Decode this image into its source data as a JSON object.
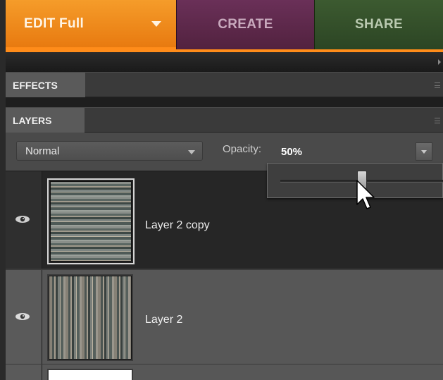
{
  "workspace_tabs": [
    {
      "label": "EDIT Full",
      "active": true,
      "color": "#e8821a"
    },
    {
      "label": "CREATE",
      "active": false,
      "color": "#5c2849"
    },
    {
      "label": "SHARE",
      "active": false,
      "color": "#34502a"
    }
  ],
  "panels": {
    "effects": {
      "title": "EFFECTS"
    },
    "layers": {
      "title": "LAYERS"
    }
  },
  "layers_controls": {
    "blend_mode": "Normal",
    "opacity_label": "Opacity:",
    "opacity_value": "50%",
    "opacity_slider_fraction": 0.5
  },
  "layers": [
    {
      "name": "Layer 2 copy",
      "visible": true,
      "selected": true,
      "thumbnail": "horizontal-stripes"
    },
    {
      "name": "Layer 2",
      "visible": true,
      "selected": false,
      "thumbnail": "vertical-stripes"
    },
    {
      "name": "",
      "visible": false,
      "selected": false,
      "thumbnail": "white"
    }
  ],
  "icons": {
    "visibility": "eye-icon",
    "dropdown": "chevron-down-icon",
    "panel_menu": "panel-menu-icon",
    "cursor": "mouse-pointer-icon"
  }
}
